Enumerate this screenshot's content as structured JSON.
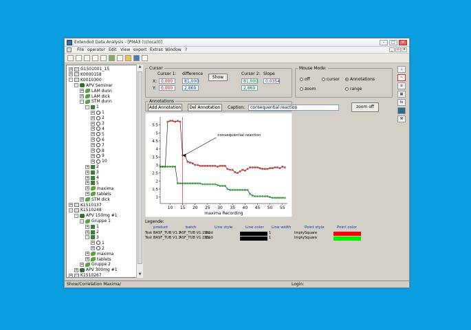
{
  "window": {
    "title": "Extended Data Analysis - [PMA3 (\\\\(local))]"
  },
  "menu": [
    "File",
    "operator",
    "Edit",
    "View",
    "export",
    "Extras",
    "Window",
    "?"
  ],
  "tree": {
    "nodes": [
      {
        "label": "G1501001_15",
        "depth": 0,
        "icon": "box",
        "exp": "+"
      },
      {
        "label": "K0000158",
        "depth": 0,
        "icon": "box",
        "exp": "+"
      },
      {
        "label": "K0010300",
        "depth": 0,
        "icon": "box",
        "exp": "-"
      },
      {
        "label": "APV Seminar",
        "depth": 1,
        "icon": "pill",
        "exp": "-"
      },
      {
        "label": "LAM dunn",
        "depth": 2,
        "icon": "leaf",
        "exp": "+"
      },
      {
        "label": "LAM dick",
        "depth": 2,
        "icon": "leaf",
        "exp": "+"
      },
      {
        "label": "STM dunn",
        "depth": 2,
        "icon": "leaf",
        "exp": "-"
      },
      {
        "label": "1",
        "depth": 3,
        "icon": "flask",
        "exp": "-"
      },
      {
        "label": "1",
        "depth": 4,
        "icon": "circ",
        "exp": "+"
      },
      {
        "label": "2",
        "depth": 4,
        "icon": "circ",
        "exp": "+"
      },
      {
        "label": "3",
        "depth": 4,
        "icon": "circ",
        "exp": "+"
      },
      {
        "label": "4",
        "depth": 4,
        "icon": "circ",
        "exp": "+"
      },
      {
        "label": "5",
        "depth": 4,
        "icon": "circ",
        "exp": "+"
      },
      {
        "label": "6",
        "depth": 4,
        "icon": "circ",
        "exp": "+"
      },
      {
        "label": "7",
        "depth": 4,
        "icon": "circ",
        "exp": "+"
      },
      {
        "label": "8",
        "depth": 4,
        "icon": "circ",
        "exp": "+"
      },
      {
        "label": "9",
        "depth": 4,
        "icon": "circ",
        "exp": "+"
      },
      {
        "label": "10",
        "depth": 4,
        "icon": "circ",
        "exp": "+"
      },
      {
        "label": "2",
        "depth": 3,
        "icon": "flask",
        "exp": "+"
      },
      {
        "label": "3",
        "depth": 3,
        "icon": "flask",
        "exp": "+"
      },
      {
        "label": "4",
        "depth": 3,
        "icon": "flask",
        "exp": "+"
      },
      {
        "label": "5",
        "depth": 3,
        "icon": "flask",
        "exp": "+"
      },
      {
        "label": "maxima",
        "depth": 3,
        "icon": "leaf",
        "exp": "+"
      },
      {
        "label": "tablets",
        "depth": 3,
        "icon": "leaf",
        "exp": "+"
      },
      {
        "label": "STM dick",
        "depth": 2,
        "icon": "leaf",
        "exp": "+"
      },
      {
        "label": "K1510137",
        "depth": 0,
        "icon": "box",
        "exp": "+"
      },
      {
        "label": "K1510248",
        "depth": 0,
        "icon": "box",
        "exp": "-"
      },
      {
        "label": "APV 150mg #1",
        "depth": 1,
        "icon": "pill",
        "exp": "-"
      },
      {
        "label": "Gruppe 1",
        "depth": 2,
        "icon": "leaf",
        "exp": "-"
      },
      {
        "label": "1",
        "depth": 3,
        "icon": "flask",
        "exp": "+"
      },
      {
        "label": "2",
        "depth": 3,
        "icon": "flask",
        "exp": "+"
      },
      {
        "label": "3",
        "depth": 3,
        "icon": "flask",
        "exp": "-"
      },
      {
        "label": "1",
        "depth": 4,
        "icon": "circ",
        "exp": "+"
      },
      {
        "label": "2",
        "depth": 4,
        "icon": "circ",
        "exp": "+"
      },
      {
        "label": "maxima",
        "depth": 3,
        "icon": "leaf",
        "exp": "+"
      },
      {
        "label": "tablets",
        "depth": 3,
        "icon": "leaf",
        "exp": "+"
      },
      {
        "label": "Gruppe 2",
        "depth": 2,
        "icon": "leaf",
        "exp": "+"
      },
      {
        "label": "APV 300mg #1",
        "depth": 1,
        "icon": "pill",
        "exp": "+"
      },
      {
        "label": "K1510267",
        "depth": 0,
        "icon": "box",
        "exp": "+"
      }
    ]
  },
  "cursor": {
    "group": "Cursor",
    "c1_label": "Cursor 1:",
    "diff_label": "difference",
    "c2_label": "Cursor 2:",
    "slope_label": "Slope",
    "x_label": "X:",
    "y_label": "Y:",
    "c1_x": "0,000",
    "c1_y": "0,000",
    "diff_x": "81,000",
    "diff_y": "2,869",
    "c2_x": "81,000",
    "c2_y": "2,869",
    "slope": "0,0354",
    "show": "Show"
  },
  "mouse_mode": {
    "group": "Mouse Mode:",
    "options": [
      "off",
      "cursor",
      "Annotations",
      "zoom",
      "range"
    ],
    "selected": "Annotations"
  },
  "annotations": {
    "group": "Annotations",
    "add": "Add Annotation",
    "del": "Del Annotation",
    "caption_label": "Caption:",
    "caption_value": "consequential reaction",
    "zoom_off": "zoom off"
  },
  "chart_data": {
    "type": "line",
    "xlabel": "maxima Recording",
    "ylabel": "",
    "xlim": [
      6,
      57
    ],
    "ylim": [
      0.6,
      6
    ],
    "x_ticks": [
      10,
      15,
      20,
      25,
      30,
      35,
      40,
      45,
      50,
      55
    ],
    "y_ticks": [
      1,
      1.5,
      2,
      2.5,
      3,
      3.5,
      4,
      4.5,
      5,
      5.5
    ],
    "annotation": {
      "text": "consequential reaction",
      "x": 15,
      "y": 3.6,
      "text_x": 29,
      "text_y": 4.8
    },
    "cursor_x": 15,
    "series": [
      {
        "color": "#cc2222",
        "x": [
          6,
          7,
          8,
          9,
          10,
          11,
          12,
          13,
          14,
          15,
          16,
          17,
          18,
          19,
          20,
          21,
          22,
          23,
          24,
          25,
          26,
          27,
          28,
          29,
          30,
          31,
          32,
          33,
          34,
          35,
          36,
          37,
          38,
          39,
          40,
          41,
          42,
          43,
          44,
          45,
          46,
          47,
          48,
          49,
          50,
          51,
          52,
          53,
          54,
          55,
          56
        ],
        "values": [
          2.9,
          2.9,
          2.9,
          5.7,
          5.75,
          5.75,
          5.7,
          5.75,
          5.7,
          3.6,
          3.55,
          3.2,
          3.15,
          3.1,
          3.0,
          3.0,
          2.95,
          2.95,
          2.95,
          2.95,
          2.95,
          2.95,
          2.95,
          2.9,
          2.95,
          2.95,
          2.95,
          2.75,
          2.7,
          2.7,
          2.55,
          2.5,
          2.6,
          2.7,
          2.65,
          2.75,
          2.85,
          2.85,
          2.85,
          2.85,
          2.8,
          2.75,
          2.75,
          2.75,
          2.8,
          2.8,
          2.85,
          2.85,
          2.8,
          2.9,
          2.85
        ]
      },
      {
        "color": "#22aa22",
        "x": [
          6,
          7,
          8,
          9,
          10,
          11,
          12,
          13,
          14,
          15,
          16,
          17,
          18,
          19,
          20,
          21,
          22,
          23,
          24,
          25,
          26,
          27,
          28,
          29,
          30,
          31,
          32,
          33,
          34,
          35,
          36,
          37,
          38,
          39,
          40,
          41,
          42,
          43,
          44,
          45,
          46,
          47,
          48,
          49,
          50,
          51,
          52,
          53,
          54,
          55,
          56
        ],
        "values": [
          2.9,
          2.9,
          2.9,
          2.9,
          2.9,
          2.9,
          2.9,
          1.85,
          1.85,
          1.85,
          1.85,
          1.85,
          1.85,
          1.85,
          1.85,
          1.85,
          1.85,
          1.8,
          1.8,
          1.8,
          1.8,
          1.8,
          1.8,
          1.75,
          1.7,
          1.7,
          1.7,
          1.5,
          1.45,
          1.45,
          1.45,
          1.45,
          1.45,
          1.45,
          1.45,
          1.45,
          1.2,
          1.1,
          1.05,
          1.05,
          1.05,
          1.05,
          1.05,
          1.05,
          1.0,
          0.95,
          0.95,
          0.95,
          0.95,
          0.95,
          0.95
        ]
      }
    ]
  },
  "legend": {
    "title": "Legende:",
    "headers": [
      "product",
      "batch",
      "Line style",
      "Line color",
      "Line width",
      "Point style",
      "Point color"
    ],
    "rows": [
      {
        "product": "Test BASF_TUB V1.3",
        "batch": "ASF_TUB V1.1 EL",
        "line_style": "Solid",
        "line_width": "1",
        "point_style": "ImptySquare",
        "line_color": "#000000",
        "point_color": "#ff0000"
      },
      {
        "product": "Test BASF_TUB V1.3",
        "batch": "ASF_TUB V1.1 EL",
        "line_style": "Solid",
        "line_width": "1",
        "point_style": "ImptySquare",
        "line_color": "#000000",
        "point_color": "#00ee00"
      }
    ]
  },
  "status": {
    "left": "Show/Correlation Maxima/",
    "right": "Login:"
  }
}
